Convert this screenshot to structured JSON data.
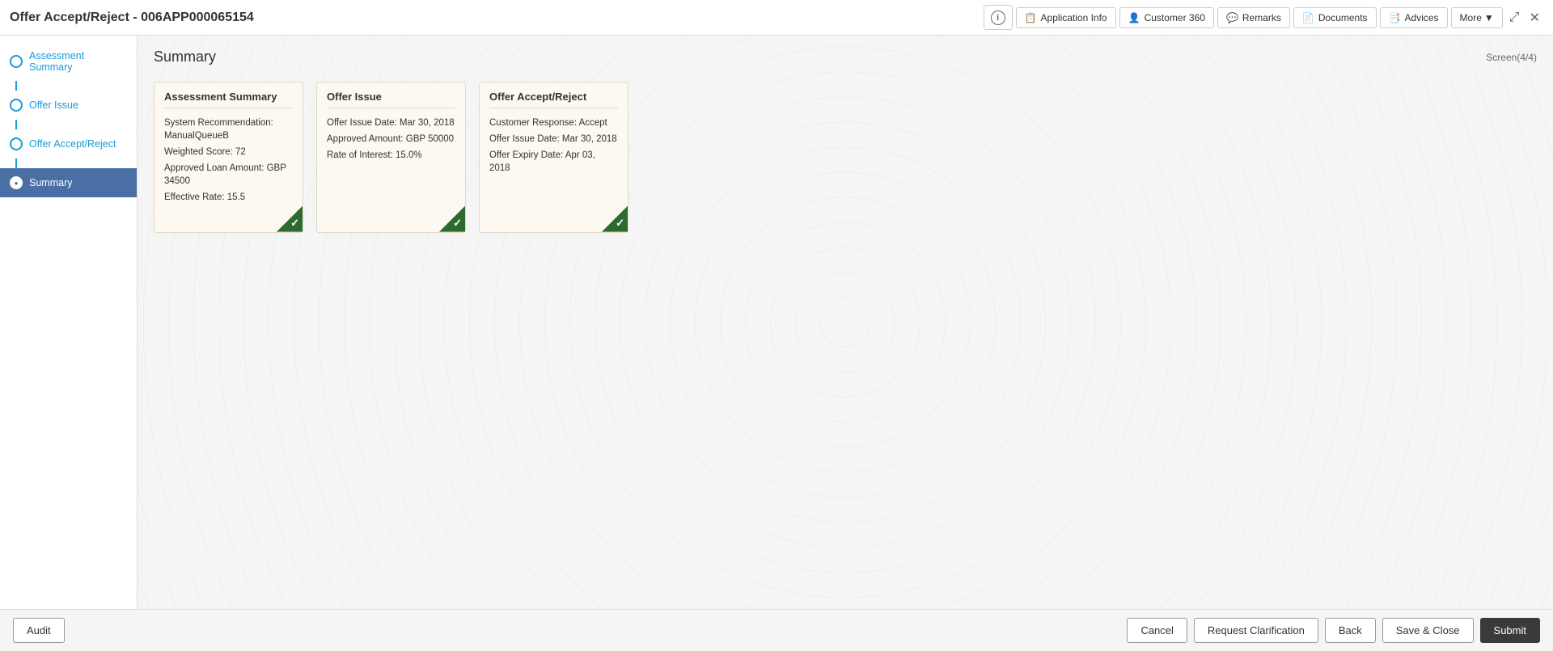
{
  "header": {
    "title": "Offer Accept/Reject - 006APP000065154",
    "buttons": {
      "info": "i",
      "application_info": "Application Info",
      "customer_360": "Customer 360",
      "remarks": "Remarks",
      "documents": "Documents",
      "advices": "Advices",
      "more": "More"
    }
  },
  "sidebar": {
    "items": [
      {
        "id": "assessment-summary",
        "label": "Assessment Summary",
        "active": false
      },
      {
        "id": "offer-issue",
        "label": "Offer Issue",
        "active": false
      },
      {
        "id": "offer-accept-reject",
        "label": "Offer Accept/Reject",
        "active": false
      },
      {
        "id": "summary",
        "label": "Summary",
        "active": true
      }
    ]
  },
  "content": {
    "title": "Summary",
    "screen_info": "Screen(4/4)",
    "cards": [
      {
        "id": "assessment-summary-card",
        "title": "Assessment Summary",
        "rows": [
          "System Recommendation: ManualQueueB",
          "Weighted Score: 72",
          "Approved Loan Amount: GBP 34500",
          "Effective Rate: 15.5"
        ],
        "has_check": true
      },
      {
        "id": "offer-issue-card",
        "title": "Offer Issue",
        "rows": [
          "Offer Issue Date: Mar 30, 2018",
          "Approved Amount: GBP 50000",
          "Rate of Interest: 15.0%"
        ],
        "has_check": true
      },
      {
        "id": "offer-accept-reject-card",
        "title": "Offer Accept/Reject",
        "rows": [
          "Customer Response: Accept",
          "Offer Issue Date: Mar 30, 2018",
          "Offer Expiry Date: Apr 03, 2018"
        ],
        "has_check": true
      }
    ]
  },
  "footer": {
    "audit_label": "Audit",
    "cancel_label": "Cancel",
    "request_clarification_label": "Request Clarification",
    "back_label": "Back",
    "save_close_label": "Save & Close",
    "submit_label": "Submit"
  }
}
